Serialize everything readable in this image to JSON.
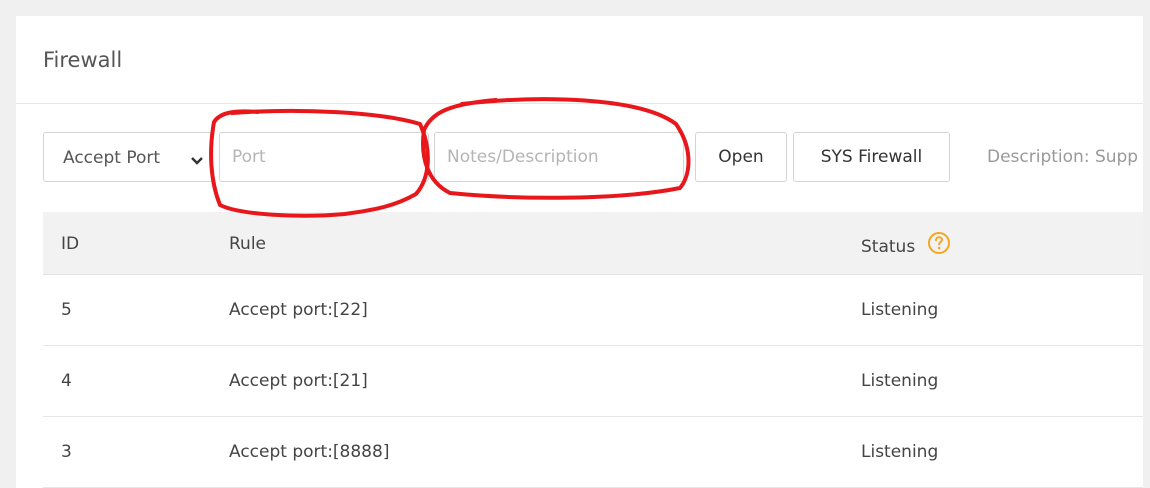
{
  "panel": {
    "title": "Firewall"
  },
  "toolbar": {
    "rule_type_selected": "Accept Port",
    "port_placeholder": "Port",
    "notes_placeholder": "Notes/Description",
    "open_label": "Open",
    "sys_firewall_label": "SYS Firewall",
    "description_text": "Description: Supp"
  },
  "table": {
    "headers": {
      "id": "ID",
      "rule": "Rule",
      "status": "Status"
    },
    "rows": [
      {
        "id": "5",
        "rule": "Accept port:[22]",
        "status": "Listening"
      },
      {
        "id": "4",
        "rule": "Accept port:[21]",
        "status": "Listening"
      },
      {
        "id": "3",
        "rule": "Accept port:[8888]",
        "status": "Listening"
      }
    ]
  },
  "icons": {
    "help": "question-circle-icon",
    "dropdown": "chevron-down-icon"
  },
  "colors": {
    "annotation": "#e8171b",
    "help_icon": "#f5a623"
  }
}
